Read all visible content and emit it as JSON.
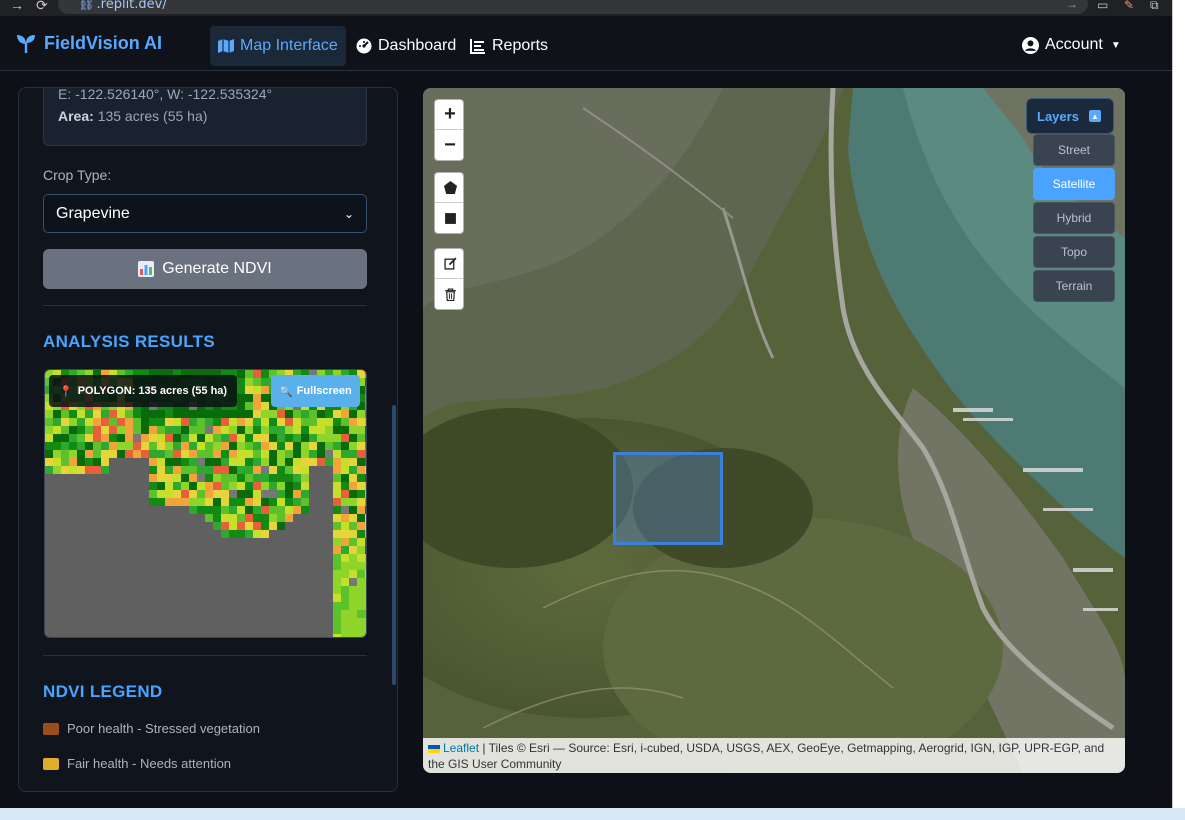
{
  "browser": {
    "url": ".replit.dev/"
  },
  "navbar": {
    "brand": "FieldVision AI",
    "items": [
      {
        "label": "Map Interface",
        "icon": "map-icon",
        "active": true
      },
      {
        "label": "Dashboard",
        "icon": "gauge-icon",
        "active": false
      },
      {
        "label": "Reports",
        "icon": "list-icon",
        "active": false
      }
    ],
    "account_label": "Account"
  },
  "sidebar": {
    "coords_line": "E: -122.526140°, W: -122.535324°",
    "area_label": "Area:",
    "area_value": "135 acres (55 ha)",
    "crop_label": "Crop Type:",
    "crop_value": "Grapevine",
    "generate_label": "Generate NDVI",
    "analysis_title": "ANALYSIS RESULTS",
    "polygon_badge": "POLYGON: 135 acres (55 ha)",
    "fullscreen_label": "Fullscreen",
    "legend_title": "NDVI LEGEND",
    "legend": [
      {
        "label": "Poor health - Stressed vegetation",
        "color": "#9a4e1c"
      },
      {
        "label": "Fair health - Needs attention",
        "color": "#e0ac2c"
      }
    ]
  },
  "map": {
    "zoom_in": "+",
    "zoom_out": "−",
    "layers_title": "Layers",
    "layers": [
      {
        "label": "Street",
        "selected": false
      },
      {
        "label": "Satellite",
        "selected": true
      },
      {
        "label": "Hybrid",
        "selected": false
      },
      {
        "label": "Topo",
        "selected": false
      },
      {
        "label": "Terrain",
        "selected": false
      }
    ],
    "attribution_link": "Leaflet",
    "attribution_text": " | Tiles © Esri — Source: Esri, i-cubed, USDA, USGS, AEX, GeoEye, Getmapping, Aerogrid, IGN, IGP, UPR-EGP, and the GIS User Community"
  },
  "colors": {
    "accent": "#4aa3ff",
    "background": "#0d1117",
    "selected_layer": "#4aa3ff"
  }
}
